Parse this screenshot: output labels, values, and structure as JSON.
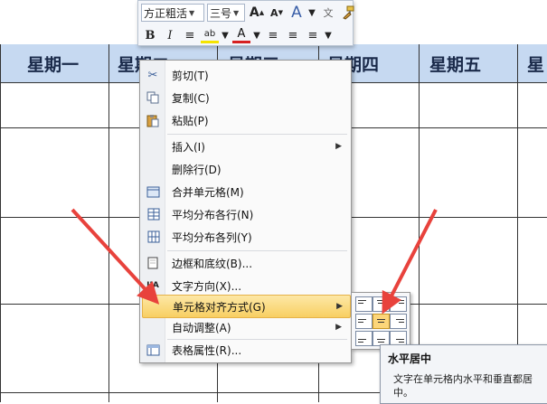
{
  "table": {
    "headers": [
      "星期一",
      "星期二",
      "星期三",
      "星期四",
      "星期五",
      "星"
    ]
  },
  "mini_toolbar": {
    "font_name": "方正粗活",
    "font_size": "三号",
    "buttons_row1": [
      "A",
      "A",
      "A",
      "文"
    ],
    "buttons_row2": [
      "B",
      "I",
      "≡",
      "ab",
      "A",
      "≡",
      "≡",
      "≡"
    ]
  },
  "menu": {
    "items": [
      {
        "label": "剪切(T)",
        "icon": "scissors-icon"
      },
      {
        "label": "复制(C)",
        "icon": "copy-icon"
      },
      {
        "label": "粘贴(P)",
        "icon": "paste-icon"
      },
      {
        "label": "插入(I)",
        "submenu": true
      },
      {
        "label": "删除行(D)"
      },
      {
        "label": "合并单元格(M)",
        "icon": "merge-cells-icon"
      },
      {
        "label": "平均分布各行(N)",
        "icon": "distribute-rows-icon"
      },
      {
        "label": "平均分布各列(Y)",
        "icon": "distribute-columns-icon"
      },
      {
        "label": "边框和底纹(B)...",
        "icon": "borders-icon"
      },
      {
        "label": "文字方向(X)...",
        "icon": "text-direction-icon"
      },
      {
        "label": "单元格对齐方式(G)",
        "submenu": true,
        "highlighted": true
      },
      {
        "label": "自动调整(A)",
        "submenu": true
      },
      {
        "label": "表格属性(R)...",
        "icon": "table-properties-icon"
      }
    ]
  },
  "tooltip": {
    "title": "水平居中",
    "body": "文字在单元格内水平和垂直都居中。"
  },
  "colors": {
    "header_fill": "#c6d9f1",
    "menu_highlight": "#f8cf62",
    "arrow": "#e8423c"
  }
}
